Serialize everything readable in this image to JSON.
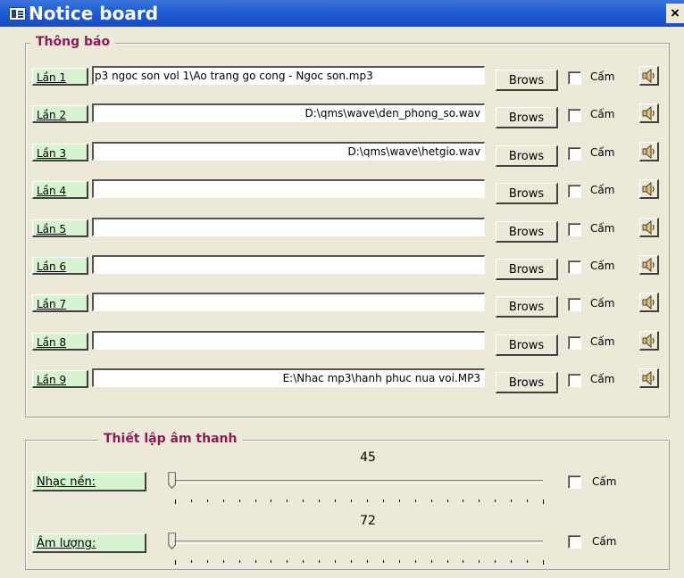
{
  "window": {
    "title": "Notice board",
    "close_label": "×"
  },
  "notice_group": {
    "title": "Thông báo",
    "rows": [
      {
        "label": "Lần 1",
        "path": "p3 ngoc son vol 1\\Ao trang go cong - Ngoc son.mp3",
        "browse": "Brows",
        "mute_label": "Cấm",
        "muted": false
      },
      {
        "label": "Lần 2",
        "path": "D:\\qms\\wave\\den_phong_so.wav",
        "browse": "Brows",
        "mute_label": "Cấm",
        "muted": false
      },
      {
        "label": "Lần 3",
        "path": "D:\\qms\\wave\\hetgio.wav",
        "browse": "Brows",
        "mute_label": "Cấm",
        "muted": false
      },
      {
        "label": "Lần 4",
        "path": "",
        "browse": "Brows",
        "mute_label": "Cấm",
        "muted": false
      },
      {
        "label": "Lần 5",
        "path": "",
        "browse": "Brows",
        "mute_label": "Cấm",
        "muted": false
      },
      {
        "label": "Lần 6",
        "path": "",
        "browse": "Brows",
        "mute_label": "Cấm",
        "muted": false
      },
      {
        "label": "Lần 7",
        "path": "",
        "browse": "Brows",
        "mute_label": "Cấm",
        "muted": false
      },
      {
        "label": "Lần 8",
        "path": "",
        "browse": "Brows",
        "mute_label": "Cấm",
        "muted": false
      },
      {
        "label": "Lần 9",
        "path": "E:\\Nhac mp3\\hanh phuc nua voi.MP3",
        "browse": "Brows",
        "mute_label": "Cấm",
        "muted": false
      }
    ]
  },
  "sound_group": {
    "title": "Thiết lập âm thanh",
    "background_music": {
      "label": "Nhạc nền:",
      "value": "45",
      "mute_label": "Cấm",
      "muted": false
    },
    "volume": {
      "label": "Âm lượng:",
      "value": "72",
      "mute_label": "Cấm",
      "muted": false
    }
  },
  "colors": {
    "titlebar": "#1c5ad0",
    "window_bg": "#ece9d8",
    "group_title": "#8b1a5a",
    "label_button_bg": "#d8f3d0"
  },
  "icons": {
    "row_sound_button": "speaker-icon",
    "window_icon": "form-icon"
  }
}
